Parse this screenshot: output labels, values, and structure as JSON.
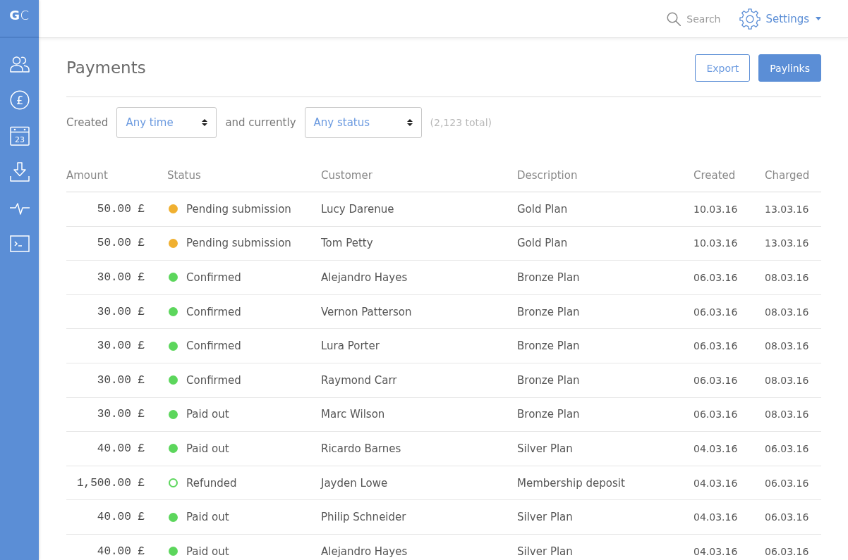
{
  "sidebar": {
    "logo": "**G**C",
    "items": [
      {
        "kind": "users"
      },
      {
        "kind": "pound",
        "text": "£"
      },
      {
        "kind": "calendar",
        "text": "23"
      },
      {
        "kind": "download"
      },
      {
        "kind": "pulse"
      },
      {
        "kind": "terminal"
      }
    ]
  },
  "topbar": {
    "search": "Search",
    "settings": "Settings"
  },
  "header": {
    "title": "Payments",
    "buttons": [
      {
        "label": "Export",
        "kind": "outline"
      },
      {
        "label": "Paylinks",
        "kind": "primary"
      }
    ]
  },
  "filters": {
    "created_label": "Created",
    "created_value": "Any time",
    "status_label": "and currently",
    "status_value": "Any status",
    "total": "(2,123 total)"
  },
  "table": {
    "columns": [
      "Amount",
      "Status",
      "Customer",
      "Description",
      "Created",
      "Charged"
    ],
    "rows": [
      {
        "amount": "50.00 £",
        "status": {
          "label": "Pending submission",
          "color": "#f0b030",
          "kind": "dot"
        },
        "customer": "Lucy Darenue",
        "description": "Gold Plan",
        "created": "10.03.16",
        "charged": "13.03.16"
      },
      {
        "amount": "50.00 £",
        "status": {
          "label": "Pending submission",
          "color": "#f0b030",
          "kind": "dot"
        },
        "customer": "Tom Petty",
        "description": "Gold Plan",
        "created": "10.03.16",
        "charged": "13.03.16"
      },
      {
        "amount": "30.00 £",
        "status": {
          "label": "Confirmed",
          "color": "#5cd65c",
          "kind": "dot"
        },
        "customer": "Alejandro Hayes",
        "description": "Bronze Plan",
        "created": "06.03.16",
        "charged": "08.03.16"
      },
      {
        "amount": "30.00 £",
        "status": {
          "label": "Confirmed",
          "color": "#5cd65c",
          "kind": "dot"
        },
        "customer": "Vernon Patterson",
        "description": "Bronze Plan",
        "created": "06.03.16",
        "charged": "08.03.16"
      },
      {
        "amount": "30.00 £",
        "status": {
          "label": "Confirmed",
          "color": "#5cd65c",
          "kind": "dot"
        },
        "customer": "Lura Porter",
        "description": "Bronze Plan",
        "created": "06.03.16",
        "charged": "08.03.16"
      },
      {
        "amount": "30.00 £",
        "status": {
          "label": "Confirmed",
          "color": "#5cd65c",
          "kind": "dot"
        },
        "customer": "Raymond Carr",
        "description": "Bronze Plan",
        "created": "06.03.16",
        "charged": "08.03.16"
      },
      {
        "amount": "30.00 £",
        "status": {
          "label": "Paid out",
          "color": "#5cd65c",
          "kind": "dot"
        },
        "customer": "Marc Wilson",
        "description": "Bronze Plan",
        "created": "06.03.16",
        "charged": "08.03.16"
      },
      {
        "amount": "40.00 £",
        "status": {
          "label": "Paid out",
          "color": "#5cd65c",
          "kind": "dot"
        },
        "customer": "Ricardo Barnes",
        "description": "Silver Plan",
        "created": "04.03.16",
        "charged": "06.03.16"
      },
      {
        "amount": "1,500.00 £",
        "status": {
          "label": "Refunded",
          "color": "#5cd65c",
          "kind": "ring"
        },
        "customer": "Jayden Lowe",
        "description": "Membership deposit",
        "created": "04.03.16",
        "charged": "06.03.16"
      },
      {
        "amount": "40.00 £",
        "status": {
          "label": "Paid out",
          "color": "#5cd65c",
          "kind": "dot"
        },
        "customer": "Philip Schneider",
        "description": "Silver Plan",
        "created": "04.03.16",
        "charged": "06.03.16"
      },
      {
        "amount": "40.00 £",
        "status": {
          "label": "Paid out",
          "color": "#5cd65c",
          "kind": "dot"
        },
        "customer": "Alejandro Hayes",
        "description": "Silver Plan",
        "created": "04.03.16",
        "charged": "06.03.16"
      }
    ]
  }
}
